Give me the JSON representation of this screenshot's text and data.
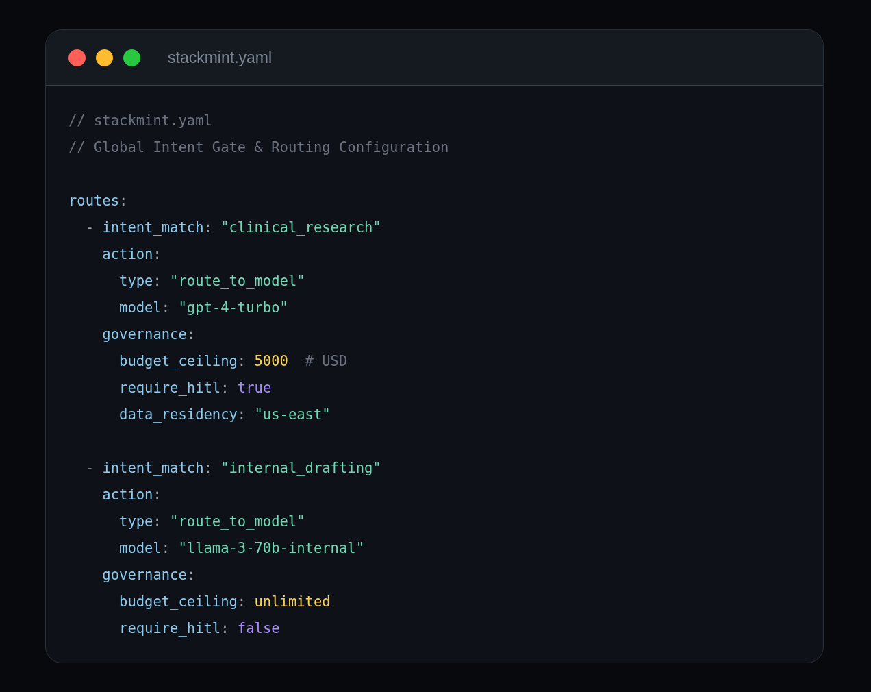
{
  "window": {
    "title": "stackmint.yaml",
    "controls": [
      {
        "kind": "close"
      },
      {
        "kind": "minimize"
      },
      {
        "kind": "zoom"
      }
    ]
  },
  "code": {
    "lines": [
      {
        "kind": "code",
        "tokens": [
          {
            "kind": "comment",
            "text": "// stackmint.yaml"
          }
        ]
      },
      {
        "kind": "code",
        "tokens": [
          {
            "kind": "comment",
            "text": "// Global Intent Gate & Routing Configuration"
          }
        ]
      },
      {
        "kind": "blank"
      },
      {
        "kind": "code",
        "tokens": [
          {
            "kind": "key",
            "text": "routes"
          },
          {
            "kind": "punct",
            "text": ":"
          }
        ]
      },
      {
        "kind": "code",
        "tokens": [
          {
            "kind": "punct",
            "text": "  - "
          },
          {
            "kind": "key",
            "text": "intent_match"
          },
          {
            "kind": "punct",
            "text": ": "
          },
          {
            "kind": "string",
            "text": "\"clinical_research\""
          }
        ]
      },
      {
        "kind": "code",
        "tokens": [
          {
            "kind": "key",
            "text": "    action"
          },
          {
            "kind": "punct",
            "text": ":"
          }
        ]
      },
      {
        "kind": "code",
        "tokens": [
          {
            "kind": "key",
            "text": "      type"
          },
          {
            "kind": "punct",
            "text": ": "
          },
          {
            "kind": "string",
            "text": "\"route_to_model\""
          }
        ]
      },
      {
        "kind": "code",
        "tokens": [
          {
            "kind": "key",
            "text": "      model"
          },
          {
            "kind": "punct",
            "text": ": "
          },
          {
            "kind": "string",
            "text": "\"gpt-4-turbo\""
          }
        ]
      },
      {
        "kind": "code",
        "tokens": [
          {
            "kind": "key",
            "text": "    governance"
          },
          {
            "kind": "punct",
            "text": ":"
          }
        ]
      },
      {
        "kind": "code",
        "tokens": [
          {
            "kind": "key",
            "text": "      budget_ceiling"
          },
          {
            "kind": "punct",
            "text": ": "
          },
          {
            "kind": "number",
            "text": "5000"
          },
          {
            "kind": "comment",
            "text": "  # USD"
          }
        ]
      },
      {
        "kind": "code",
        "tokens": [
          {
            "kind": "key",
            "text": "      require_hitl"
          },
          {
            "kind": "punct",
            "text": ": "
          },
          {
            "kind": "bool",
            "text": "true"
          }
        ]
      },
      {
        "kind": "code",
        "tokens": [
          {
            "kind": "key",
            "text": "      data_residency"
          },
          {
            "kind": "punct",
            "text": ": "
          },
          {
            "kind": "string",
            "text": "\"us-east\""
          }
        ]
      },
      {
        "kind": "blank"
      },
      {
        "kind": "code",
        "tokens": [
          {
            "kind": "punct",
            "text": "  - "
          },
          {
            "kind": "key",
            "text": "intent_match"
          },
          {
            "kind": "punct",
            "text": ": "
          },
          {
            "kind": "string",
            "text": "\"internal_drafting\""
          }
        ]
      },
      {
        "kind": "code",
        "tokens": [
          {
            "kind": "key",
            "text": "    action"
          },
          {
            "kind": "punct",
            "text": ":"
          }
        ]
      },
      {
        "kind": "code",
        "tokens": [
          {
            "kind": "key",
            "text": "      type"
          },
          {
            "kind": "punct",
            "text": ": "
          },
          {
            "kind": "string",
            "text": "\"route_to_model\""
          }
        ]
      },
      {
        "kind": "code",
        "tokens": [
          {
            "kind": "key",
            "text": "      model"
          },
          {
            "kind": "punct",
            "text": ": "
          },
          {
            "kind": "string",
            "text": "\"llama-3-70b-internal\""
          }
        ]
      },
      {
        "kind": "code",
        "tokens": [
          {
            "kind": "key",
            "text": "    governance"
          },
          {
            "kind": "punct",
            "text": ":"
          }
        ]
      },
      {
        "kind": "code",
        "tokens": [
          {
            "kind": "key",
            "text": "      budget_ceiling"
          },
          {
            "kind": "punct",
            "text": ": "
          },
          {
            "kind": "number",
            "text": "unlimited"
          }
        ]
      },
      {
        "kind": "code",
        "tokens": [
          {
            "kind": "key",
            "text": "      require_hitl"
          },
          {
            "kind": "punct",
            "text": ": "
          },
          {
            "kind": "bool",
            "text": "false"
          }
        ]
      }
    ]
  }
}
